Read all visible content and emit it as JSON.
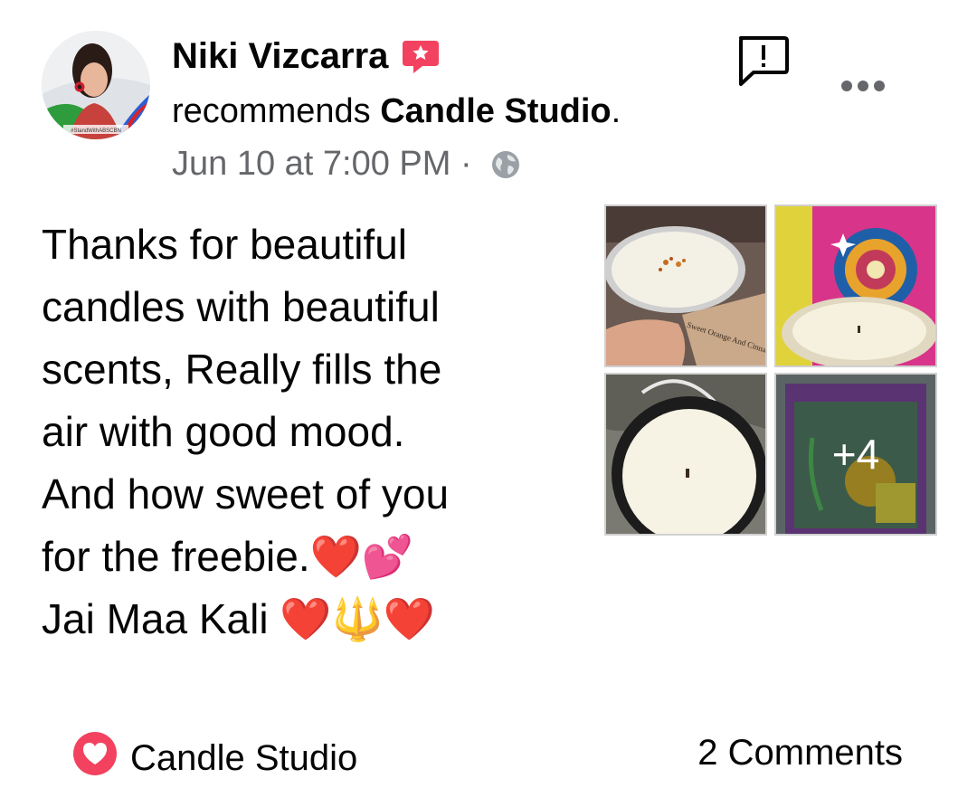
{
  "post": {
    "author": "Niki Vizcarra",
    "action_text": "recommends",
    "page_name": "Candle Studio",
    "period": ".",
    "timestamp": "Jun 10 at 7:00 PM",
    "separator": " · ",
    "avatar_caption": "#StandWithABSCBN",
    "body_text": "Thanks for beautiful\ncandles with beautiful\nscents, Really fills the\nair with good mood.\nAnd how sweet of you\nfor the freebie.❤️💕\nJai Maa Kali ❤️🔱❤️",
    "photos": {
      "more_count": "+4",
      "tag_text": "Sweet Orange And Cinnamon"
    },
    "footer": {
      "recommended_page": "Candle Studio",
      "comments": "2 Comments"
    },
    "icons": {
      "badge": "recommendation-star-icon",
      "privacy": "globe-icon",
      "report": "report-icon",
      "more": "more-options-icon",
      "heart": "heart-icon"
    },
    "colors": {
      "badge": "#f3425f",
      "secondary_text": "#65676b",
      "text": "#050505"
    }
  }
}
